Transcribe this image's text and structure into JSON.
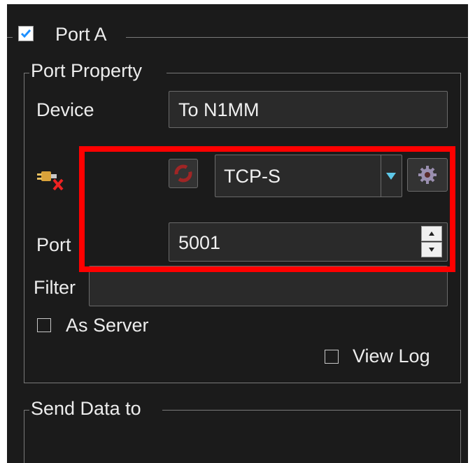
{
  "port_group": {
    "title": "Port A",
    "enabled": true
  },
  "port_property": {
    "title": "Port Property",
    "device_label": "Device",
    "device_value": "To N1MM",
    "connection_type": "TCP-S",
    "port_label": "Port",
    "port_value": "5001",
    "filter_label": "Filter",
    "filter_value": "",
    "as_server_label": "As Server",
    "as_server_checked": false,
    "view_log_label": "View Log",
    "view_log_checked": false
  },
  "send_data_group": {
    "title": "Send Data to"
  },
  "icons": {
    "connection_status": "disconnected-plug-icon",
    "refresh": "refresh-icon",
    "dropdown": "chevron-down-icon",
    "settings": "gear-icon"
  },
  "colors": {
    "highlight": "#ff0000",
    "accent_check": "#1e90ff"
  }
}
